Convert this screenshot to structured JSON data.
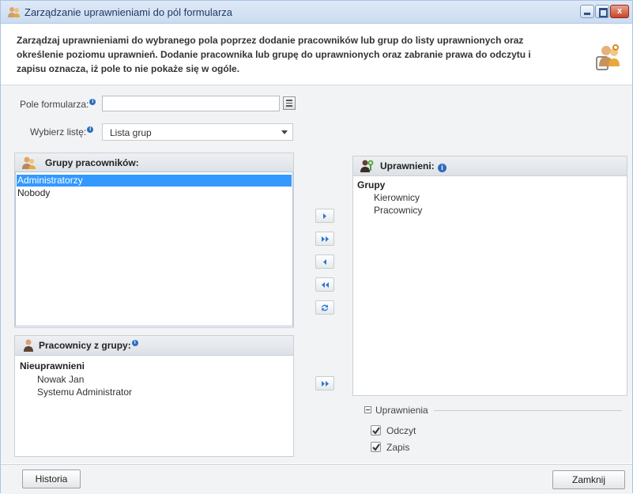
{
  "window": {
    "title": "Zarządzanie uprawnieniami do pól formularza",
    "close_label": "x"
  },
  "description": "Zarządzaj uprawnieniami do wybranego pola poprzez dodanie pracowników lub grup do listy uprawnionych oraz określenie poziomu uprawnień. Dodanie pracownika lub grupę do uprawnionych oraz zabranie prawa do odczytu i zapisu oznacza, iż pole to nie pokaże się w ogóle.",
  "form": {
    "field_label": "Pole formularza:",
    "field_value": "",
    "list_label": "Wybierz listę:",
    "list_value": "Lista grup"
  },
  "groups_panel": {
    "title": "Grupy pracowników:",
    "items": [
      {
        "label": "Administratorzy",
        "selected": true
      },
      {
        "label": "Nobody",
        "selected": false
      }
    ]
  },
  "members_panel": {
    "title": "Pracownicy z grupy:",
    "section": "Nieuprawnieni",
    "items": [
      "Nowak Jan",
      "Systemu Administrator"
    ]
  },
  "permitted_panel": {
    "title": "Uprawnieni:",
    "section": "Grupy",
    "items": [
      "Kierownicy",
      "Pracownicy"
    ]
  },
  "permissions": {
    "legend": "Uprawnienia",
    "read_label": "Odczyt",
    "read_checked": true,
    "write_label": "Zapis",
    "write_checked": true
  },
  "footer": {
    "history_button": "Historia",
    "close_button": "Zamknij"
  },
  "colors": {
    "selection": "#3399ff",
    "info_icon": "#2f6bc0",
    "transfer_arrows": "#2a78d6"
  },
  "icons": {
    "title": "users-key-icon",
    "description": "users-key-icon",
    "groups": "group-icon",
    "members": "user-icon",
    "permitted": "users-key-icon"
  }
}
